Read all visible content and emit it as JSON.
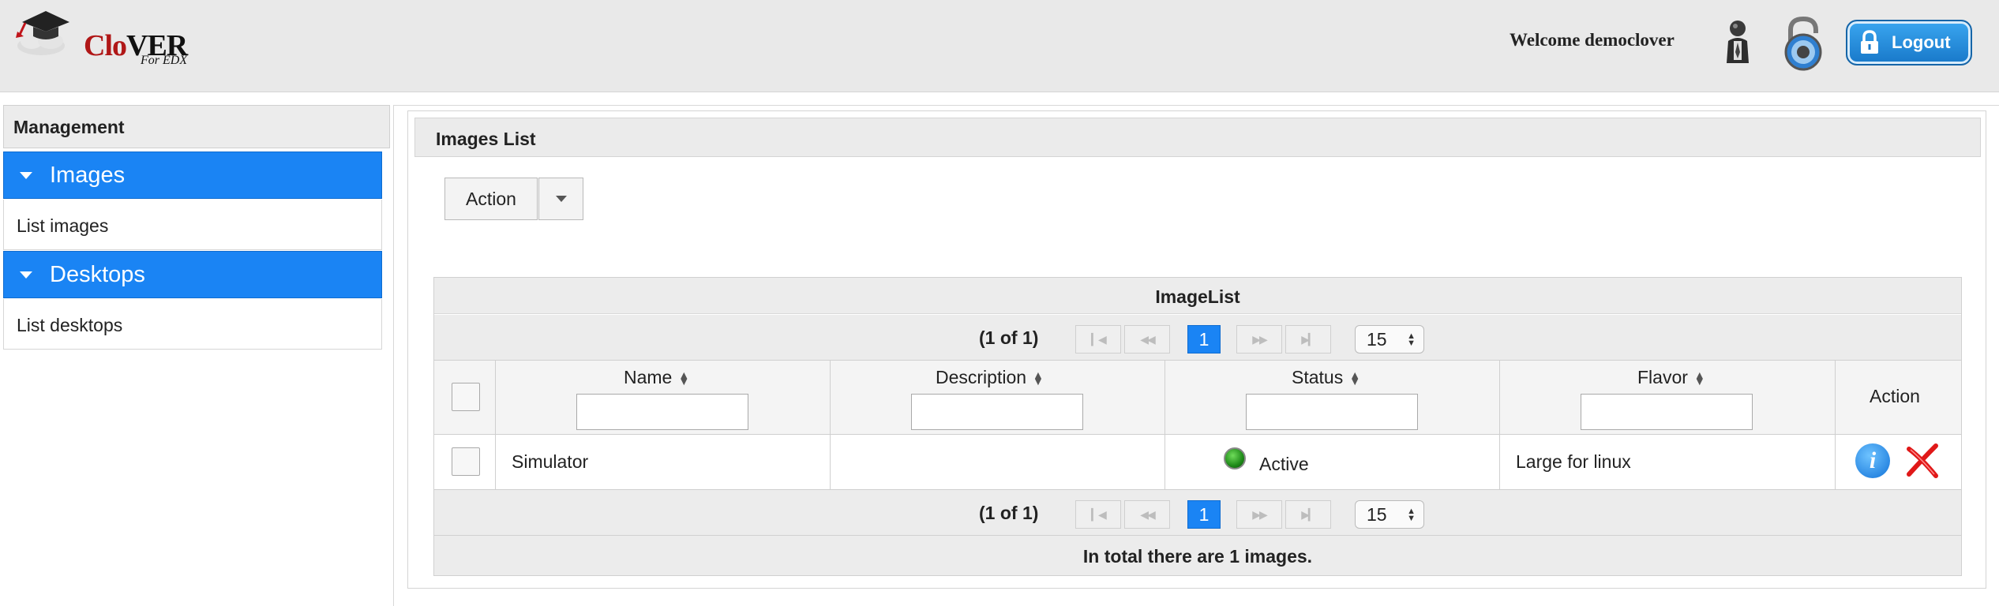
{
  "header": {
    "logo_main_1": "Clo",
    "logo_main_2": "VER",
    "logo_sub": "For EDX",
    "welcome_text": "Welcome democlover",
    "logout_label": "Logout",
    "accent_color": "#1a84f4"
  },
  "sidebar": {
    "title": "Management",
    "groups": [
      {
        "label": "Images",
        "items": [
          {
            "label": "List images"
          }
        ]
      },
      {
        "label": "Desktops",
        "items": [
          {
            "label": "List desktops"
          }
        ]
      }
    ]
  },
  "main": {
    "panel_title": "Images List",
    "action_button": "Action",
    "table": {
      "caption": "ImageList",
      "paginator": {
        "current": "(1 of 1)",
        "page": "1",
        "rows_per_page": "15"
      },
      "columns": [
        {
          "label": "Name",
          "sortable": true,
          "filter": ""
        },
        {
          "label": "Description",
          "sortable": true,
          "filter": ""
        },
        {
          "label": "Status",
          "sortable": true,
          "filter": ""
        },
        {
          "label": "Flavor",
          "sortable": true,
          "filter": ""
        },
        {
          "label": "Action",
          "sortable": false
        }
      ],
      "rows": [
        {
          "name": "Simulator",
          "description": "",
          "status": "Active",
          "status_color": "#1e8a18",
          "flavor": "Large for linux",
          "actions": [
            "info-icon",
            "delete-icon"
          ]
        }
      ],
      "footer": "In total there are 1 images."
    }
  }
}
